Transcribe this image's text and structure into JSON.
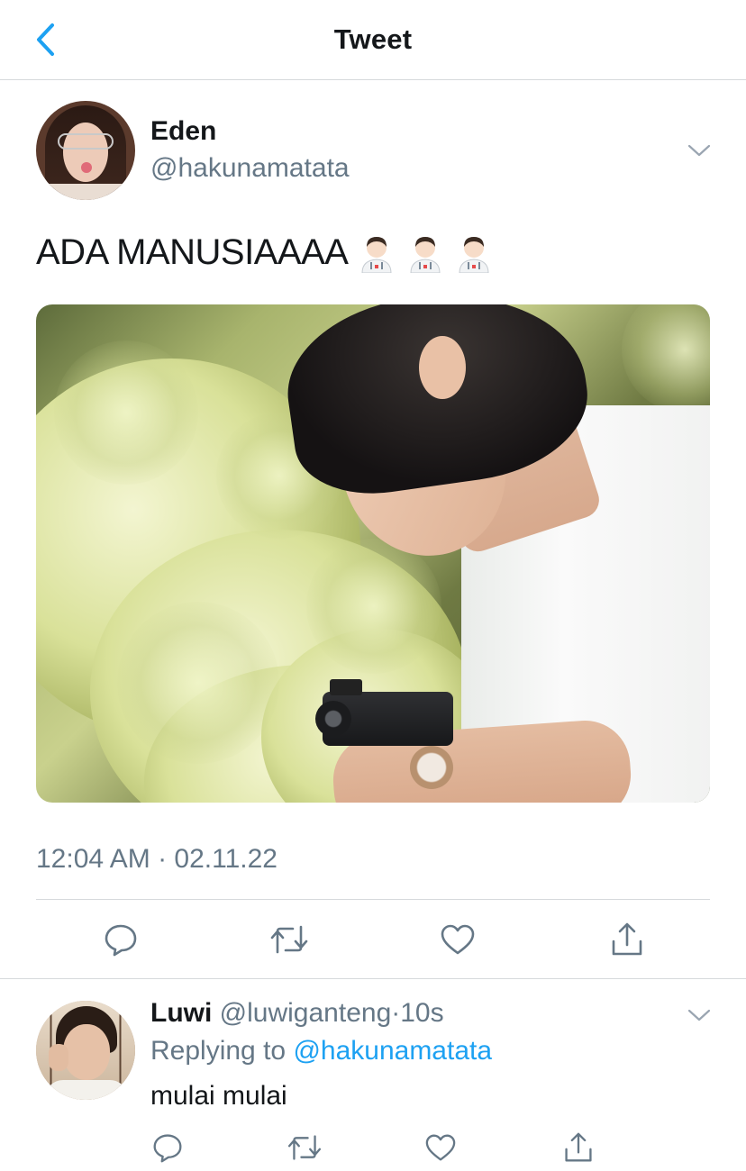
{
  "header": {
    "title": "Tweet",
    "back_icon": "chevron-left-icon"
  },
  "colors": {
    "accent": "#1da1f2",
    "muted": "#657786",
    "text": "#14171a",
    "divider": "#d6d9dc"
  },
  "tweet": {
    "author_name": "Eden",
    "author_handle": "@hakunamatata",
    "text": "ADA MANUSIAAAA",
    "emoji": [
      "man-health-worker-emoji",
      "man-health-worker-emoji",
      "man-health-worker-emoji"
    ],
    "timestamp": "12:04 AM · 02.11.22",
    "actions": [
      "reply-icon",
      "retweet-icon",
      "like-icon",
      "share-icon"
    ]
  },
  "reply": {
    "author_name": "Luwi",
    "author_handle": "@luwiganteng",
    "separator": "·",
    "time": "10s",
    "replying_prefix": "Replying to",
    "replying_to": "@hakunamatata",
    "text": "mulai mulai",
    "actions": [
      "reply-icon",
      "retweet-icon",
      "like-icon",
      "share-icon"
    ]
  }
}
